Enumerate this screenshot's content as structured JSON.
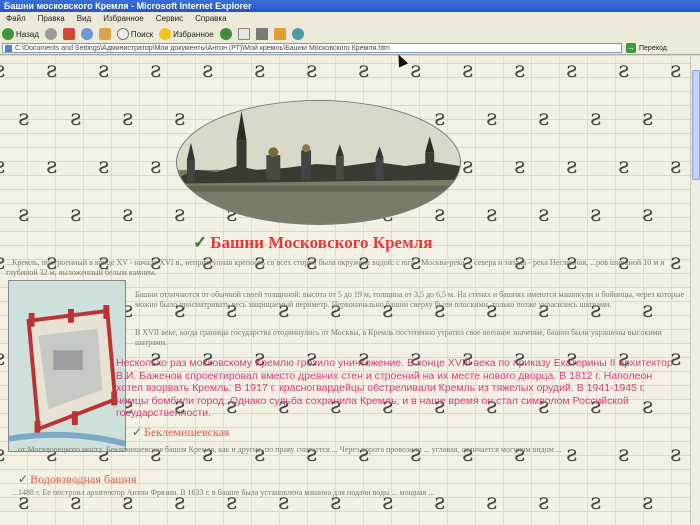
{
  "window": {
    "title": "Башни московского Кремля - Microsoft Internet Explorer"
  },
  "menu": [
    "Файл",
    "Правка",
    "Вид",
    "Избранное",
    "Сервис",
    "Справка"
  ],
  "toolbar": {
    "back": "Назад",
    "search": "Поиск",
    "favorites": "Избранное"
  },
  "address": {
    "value": "C:\\Documents and Settings\\Администратор\\Мои документы\\Антон (РТ)\\Мой кремль\\Башни Московского Кремля.htm",
    "go_label": "Переход"
  },
  "page": {
    "heading": "Башни Московского Кремля",
    "intro": "...Кремль, построенный в конце XV - начале XVI в., неприступная крепость со всех сторон была окружена водой: с юга - Москва-река, с севера и запада - река Неглинная, ...ров шириной 10 м и глубиной 32 м, выложенный белым камнем.",
    "para2": "Башни отличаются от обычной своей толщиной: высота от 5 до 19 м, толщина от 3,5 до 6,5 м. На стенах и башнях имеются машикули и бойницы, через которые можно было просматривать весь защищаемый периметр. Первоначально башни сверху были плоскими, только позже украсились шатрами.",
    "para3": "В XVII веке, когда границы государства отодвинулись от Москвы, а Кремль постепенно утратил свое военное значение, башни были украшены высокими шатрами.",
    "pink_text": "Несколько раз московскому Кремлю грозило уничтожение. В конце XVIII века по приказу Екатерины II архитектор В.И. Баженов спроектировал вместо древних стен и строений на их месте нового дворца. В 1812 г. Наполеон хотел взорвать Кремль. В 1917 г. красногвардейцы обстреливали Кремль из тяжелых орудий. В 1941-1945 г. немцы бомбили город. Однако судьба сохранила Кремль, и в наше время он стал символом Российской государственности.",
    "sub1": "Беклемишевская",
    "sub1_text": "...от Москворецкого моста. Беклемишевская башня Кремля, как и другие, по праву считается ... Через ворота провозили ... угловая, отличается могучим видом ...",
    "sub2": "Водовзводная башня",
    "sub2_text": "...1488 г. Ее построил архитектор Антон Фрязин. В 1633 г. в башне была установлена машина для подачи воды ... мощная ..."
  },
  "watermark_glyph": "ƨ",
  "colors": {
    "heading": "#e23a3a",
    "pink_text": "#d4407a",
    "muted_text": "#807a70"
  }
}
